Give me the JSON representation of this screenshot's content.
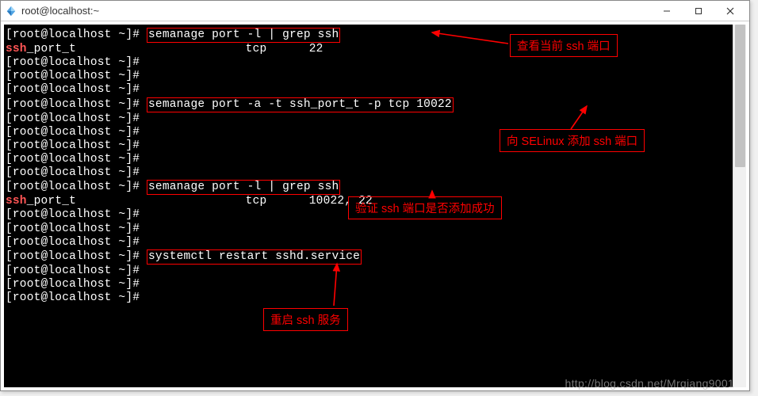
{
  "window": {
    "title": "root@localhost:~"
  },
  "prompt": "[root@localhost ~]# ",
  "commands": {
    "cmd1": "semanage port -l | grep ssh",
    "out1a": "ssh",
    "out1b": "_port_t                        tcp      22",
    "cmd2": "semanage port -a -t ssh_port_t -p tcp 10022",
    "cmd3": "semanage port -l | grep ssh",
    "out3a": "ssh",
    "out3b": "_port_t                        tcp      10022, 22",
    "cmd4": "systemctl restart sshd.service"
  },
  "annotations": {
    "a1": "查看当前 ssh 端口",
    "a2": "向 SELinux 添加 ssh 端口",
    "a3": "验证 ssh 端口是否添加成功",
    "a4": "重启 ssh 服务"
  },
  "watermark": "http://blog.csdn.net/Mrqiang9001"
}
